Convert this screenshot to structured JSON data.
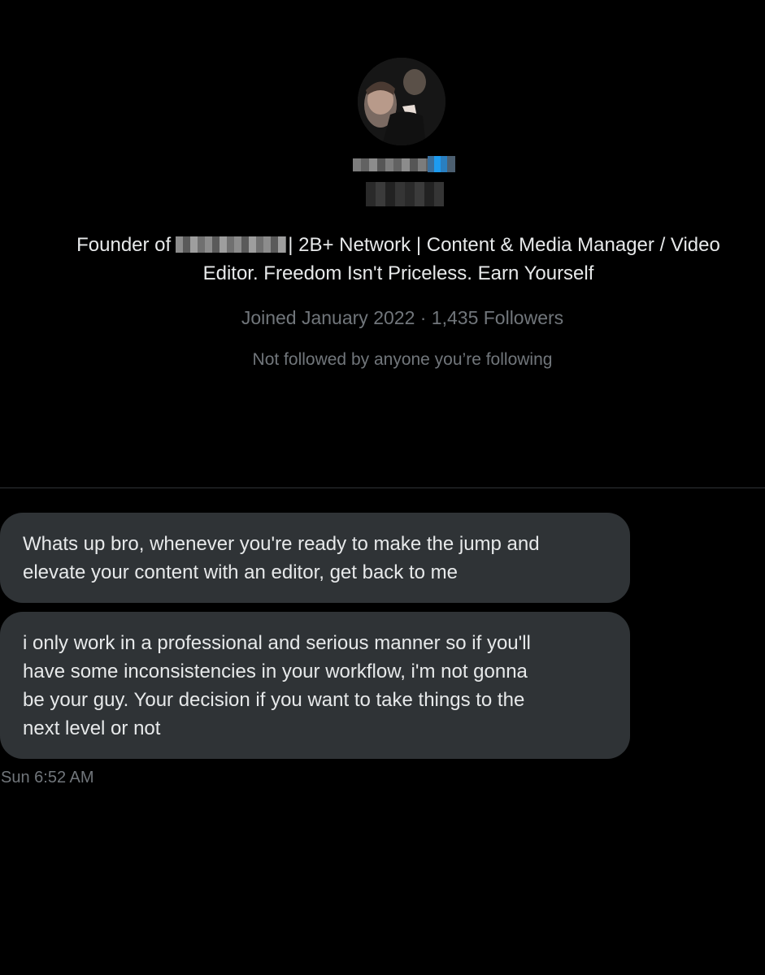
{
  "profile": {
    "bio_prefix": "Founder of",
    "bio_line1_rest": "| 2B+ Network | Content & Media Manager / Video",
    "bio_line2": "Editor. Freedom Isn't Priceless. Earn Yourself",
    "joined_followers": "Joined January 2022 · 1,435 Followers",
    "not_followed": "Not followed by anyone you’re following",
    "verified_color": "#1d9bf0"
  },
  "messages": [
    {
      "lines": [
        "Whats up bro, whenever you're ready to make the jump and",
        "elevate your content with an editor, get back to me"
      ]
    },
    {
      "lines": [
        "i only work in a professional and serious manner so if you'll",
        "have some inconsistencies in your workflow, i'm not gonna",
        "be your guy. Your decision if you want to take things to the",
        "next level or not"
      ]
    }
  ],
  "timestamp": "Sun 6:52 AM",
  "colors": {
    "background": "#000000",
    "bubble": "#2f3336",
    "text": "#e7e9ea",
    "muted": "#71767b"
  }
}
